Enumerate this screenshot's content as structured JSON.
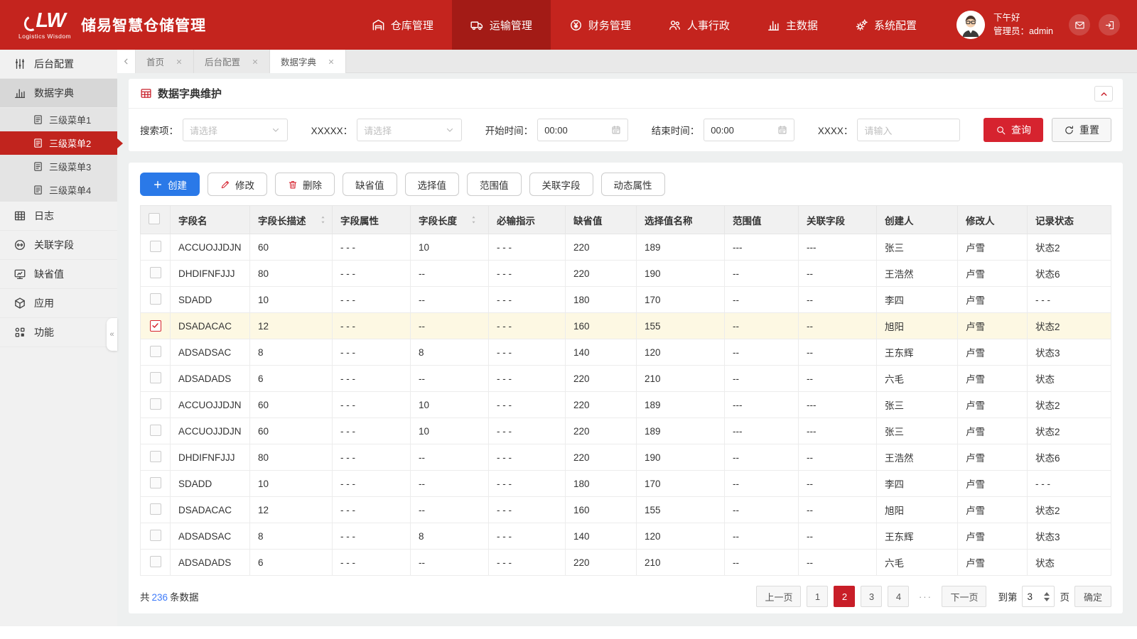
{
  "header": {
    "logo": {
      "mark": "LW",
      "subtitle": "Logistics Wisdom"
    },
    "title": "储易智慧仓储管理",
    "nav": [
      {
        "label": "仓库管理",
        "icon": "warehouse",
        "active": false
      },
      {
        "label": "运输管理",
        "icon": "truck",
        "active": true
      },
      {
        "label": "财务管理",
        "icon": "finance",
        "active": false
      },
      {
        "label": "人事行政",
        "icon": "people",
        "active": false
      },
      {
        "label": "主数据",
        "icon": "chart",
        "active": false
      },
      {
        "label": "系统配置",
        "icon": "gears",
        "active": false
      }
    ],
    "greeting": "下午好",
    "user_line": "管理员：admin"
  },
  "sidebar": {
    "items": [
      {
        "label": "后台配置",
        "icon": "sliders"
      },
      {
        "label": "数据字典",
        "icon": "chart",
        "active_section": true,
        "children": [
          {
            "label": "三级菜单1",
            "active": false
          },
          {
            "label": "三级菜单2",
            "active": true
          },
          {
            "label": "三级菜单3",
            "active": false
          },
          {
            "label": "三级菜单4",
            "active": false
          }
        ]
      },
      {
        "label": "日志",
        "icon": "grid"
      },
      {
        "label": "关联字段",
        "icon": "link"
      },
      {
        "label": "缺省值",
        "icon": "display"
      },
      {
        "label": "应用",
        "icon": "cube"
      },
      {
        "label": "功能",
        "icon": "apps"
      }
    ]
  },
  "tabs": [
    {
      "label": "首页",
      "active": false
    },
    {
      "label": "后台配置",
      "active": false
    },
    {
      "label": "数据字典",
      "active": true
    }
  ],
  "panel": {
    "title": "数据字典维护"
  },
  "filters": [
    {
      "label": "搜索项：",
      "type": "select",
      "placeholder": "请选择"
    },
    {
      "label": "XXXXX：",
      "type": "select",
      "placeholder": "请选择"
    },
    {
      "label": "开始时间：",
      "type": "time",
      "value": "00:00"
    },
    {
      "label": "结束时间：",
      "type": "time",
      "value": "00:00"
    },
    {
      "label": "XXXX：",
      "type": "text",
      "placeholder": "请输入"
    }
  ],
  "filter_actions": {
    "query": "查询",
    "reset": "重置"
  },
  "toolbar": [
    {
      "label": "创建",
      "icon": "plus",
      "variant": "primary"
    },
    {
      "label": "修改",
      "icon": "pencil",
      "variant": "default"
    },
    {
      "label": "删除",
      "icon": "trash",
      "variant": "default"
    },
    {
      "label": "缺省值"
    },
    {
      "label": "选择值"
    },
    {
      "label": "范围值"
    },
    {
      "label": "关联字段"
    },
    {
      "label": "动态属性"
    }
  ],
  "table": {
    "headers": [
      {
        "label": "字段名",
        "sortable": false
      },
      {
        "label": "字段长描述",
        "sortable": true
      },
      {
        "label": "字段属性",
        "sortable": false
      },
      {
        "label": "字段长度",
        "sortable": true
      },
      {
        "label": "必输指示",
        "sortable": false
      },
      {
        "label": "缺省值",
        "sortable": false
      },
      {
        "label": "选择值名称",
        "sortable": false
      },
      {
        "label": "范围值",
        "sortable": false
      },
      {
        "label": "关联字段",
        "sortable": false
      },
      {
        "label": "创建人",
        "sortable": false
      },
      {
        "label": "修改人",
        "sortable": false
      },
      {
        "label": "记录状态",
        "sortable": false
      }
    ],
    "rows": [
      {
        "checked": false,
        "cells": [
          "ACCUOJJDJN",
          "60",
          "- - -",
          "10",
          "- - -",
          "220",
          "189",
          "---",
          "---",
          "张三",
          "卢雪",
          "状态2"
        ]
      },
      {
        "checked": false,
        "cells": [
          "DHDIFNFJJJ",
          "80",
          "- - -",
          "--",
          "- - -",
          "220",
          "190",
          "--",
          "--",
          "王浩然",
          "卢雪",
          "状态6"
        ]
      },
      {
        "checked": false,
        "cells": [
          "SDADD",
          "10",
          "- - -",
          "--",
          "- - -",
          "180",
          "170",
          "--",
          "--",
          "李四",
          "卢雪",
          "- - -"
        ]
      },
      {
        "checked": true,
        "cells": [
          "DSADACAC",
          "12",
          "- - -",
          "--",
          "- - -",
          "160",
          "155",
          "--",
          "--",
          "旭阳",
          "卢雪",
          "状态2"
        ]
      },
      {
        "checked": false,
        "cells": [
          "ADSADSAC",
          "8",
          "- - -",
          "8",
          "- - -",
          "140",
          "120",
          "--",
          "--",
          "王东辉",
          "卢雪",
          "状态3"
        ]
      },
      {
        "checked": false,
        "cells": [
          "ADSADADS",
          "6",
          "- - -",
          "--",
          "- - -",
          "220",
          "210",
          "--",
          "--",
          "六毛",
          "卢雪",
          "状态"
        ]
      },
      {
        "checked": false,
        "cells": [
          "ACCUOJJDJN",
          "60",
          "- - -",
          "10",
          "- - -",
          "220",
          "189",
          "---",
          "---",
          "张三",
          "卢雪",
          "状态2"
        ]
      },
      {
        "checked": false,
        "cells": [
          "ACCUOJJDJN",
          "60",
          "- - -",
          "10",
          "- - -",
          "220",
          "189",
          "---",
          "---",
          "张三",
          "卢雪",
          "状态2"
        ]
      },
      {
        "checked": false,
        "cells": [
          "DHDIFNFJJJ",
          "80",
          "- - -",
          "--",
          "- - -",
          "220",
          "190",
          "--",
          "--",
          "王浩然",
          "卢雪",
          "状态6"
        ]
      },
      {
        "checked": false,
        "cells": [
          "SDADD",
          "10",
          "- - -",
          "--",
          "- - -",
          "180",
          "170",
          "--",
          "--",
          "李四",
          "卢雪",
          "- - -"
        ]
      },
      {
        "checked": false,
        "cells": [
          "DSADACAC",
          "12",
          "- - -",
          "--",
          "- - -",
          "160",
          "155",
          "--",
          "--",
          "旭阳",
          "卢雪",
          "状态2"
        ]
      },
      {
        "checked": false,
        "cells": [
          "ADSADSAC",
          "8",
          "- - -",
          "8",
          "- - -",
          "140",
          "120",
          "--",
          "--",
          "王东辉",
          "卢雪",
          "状态3"
        ]
      },
      {
        "checked": false,
        "cells": [
          "ADSADADS",
          "6",
          "- - -",
          "--",
          "- - -",
          "220",
          "210",
          "--",
          "--",
          "六毛",
          "卢雪",
          "状态"
        ]
      }
    ]
  },
  "footer": {
    "total_prefix": "共",
    "total_count": "236",
    "total_suffix": "条数据",
    "pagination": {
      "prev": "上一页",
      "pages": [
        "1",
        "2",
        "3",
        "4",
        "···"
      ],
      "active_page": "2",
      "next": "下一页",
      "jump_prefix": "到第",
      "jump_value": "3",
      "jump_suffix": "页",
      "confirm": "确定"
    }
  },
  "colors": {
    "header_red": "#c4241e",
    "nav_active_red": "#a31b16",
    "accent_red": "#d6232f",
    "submenu_red": "#c1241e",
    "primary_blue": "#2a79e8",
    "link_blue": "#3e7bfa",
    "highlight_row": "#fdf8e3"
  }
}
